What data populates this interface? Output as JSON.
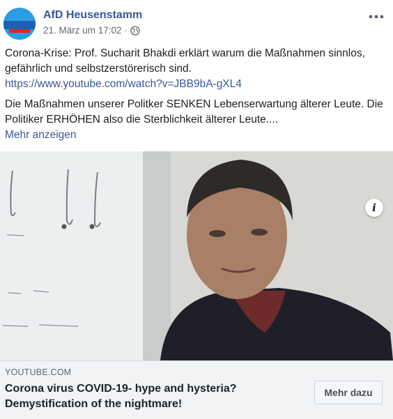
{
  "header": {
    "page_name": "AfD Heusenstamm",
    "timestamp": "21. März um 17:02",
    "separator": "·"
  },
  "post": {
    "line1": "Corona-Krise: Prof. Sucharit Bhakdi erklärt warum die Maßnahmen sinnlos, gefährlich und selbstzerstörerisch sind.",
    "url": "https://www.youtube.com/watch?v=JBB9bA-gXL4",
    "line2": "Die Maßnahmen unserer Politker SENKEN Lebenserwartung älterer Leute. Die Politiker ERHÖHEN also die Sterblichkeit älterer Leute....",
    "see_more": "Mehr anzeigen"
  },
  "media": {
    "info_icon": "i"
  },
  "link_card": {
    "domain": "YOUTUBE.COM",
    "title": "Corona virus COVID-19- hype and hysteria? Demystification of the nightmare!",
    "button_label": "Mehr dazu"
  },
  "icons": {
    "globe": "globe-icon",
    "more": "more-options-icon",
    "info": "info-icon"
  },
  "colors": {
    "link": "#385898",
    "text": "#1c1e21",
    "meta": "#606770",
    "card_bg": "#f2f3f5"
  }
}
